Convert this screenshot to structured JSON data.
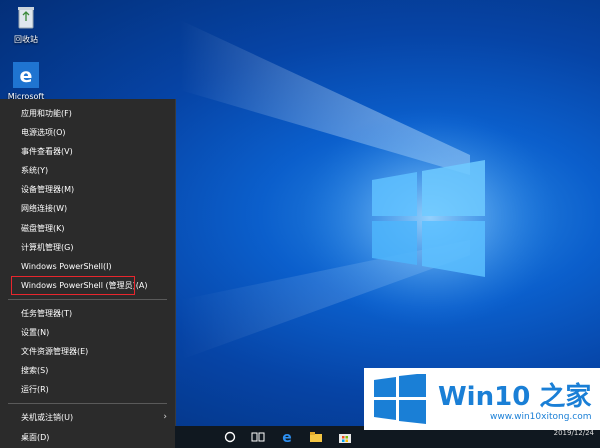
{
  "desktop": {
    "icons": [
      {
        "label": "回收站",
        "icon": "recycle-bin-icon"
      },
      {
        "label": "Microsoft",
        "icon": "edge-icon"
      }
    ]
  },
  "menu": {
    "groups": [
      [
        "应用和功能(F)",
        "电源选项(O)",
        "事件查看器(V)",
        "系统(Y)",
        "设备管理器(M)",
        "网络连接(W)",
        "磁盘管理(K)",
        "计算机管理(G)",
        "Windows PowerShell(I)",
        "Windows PowerShell (管理员)(A)"
      ],
      [
        "任务管理器(T)",
        "设置(N)",
        "文件资源管理器(E)",
        "搜索(S)",
        "运行(R)"
      ],
      [
        "关机或注销(U)",
        "桌面(D)"
      ]
    ],
    "highlighted": "Windows PowerShell (管理员)(A)",
    "highlight_color": "#e8262d",
    "submenu_arrow": "›"
  },
  "taskbar": {
    "icons": [
      "cortana-circle-icon",
      "task-view-icon",
      "edge-icon",
      "file-explorer-icon",
      "store-icon"
    ],
    "clock_date": "2019/12/24"
  },
  "watermark": {
    "brand": "Win10 之家",
    "url": "www.win10xitong.com",
    "color": "#1a7fd6"
  }
}
